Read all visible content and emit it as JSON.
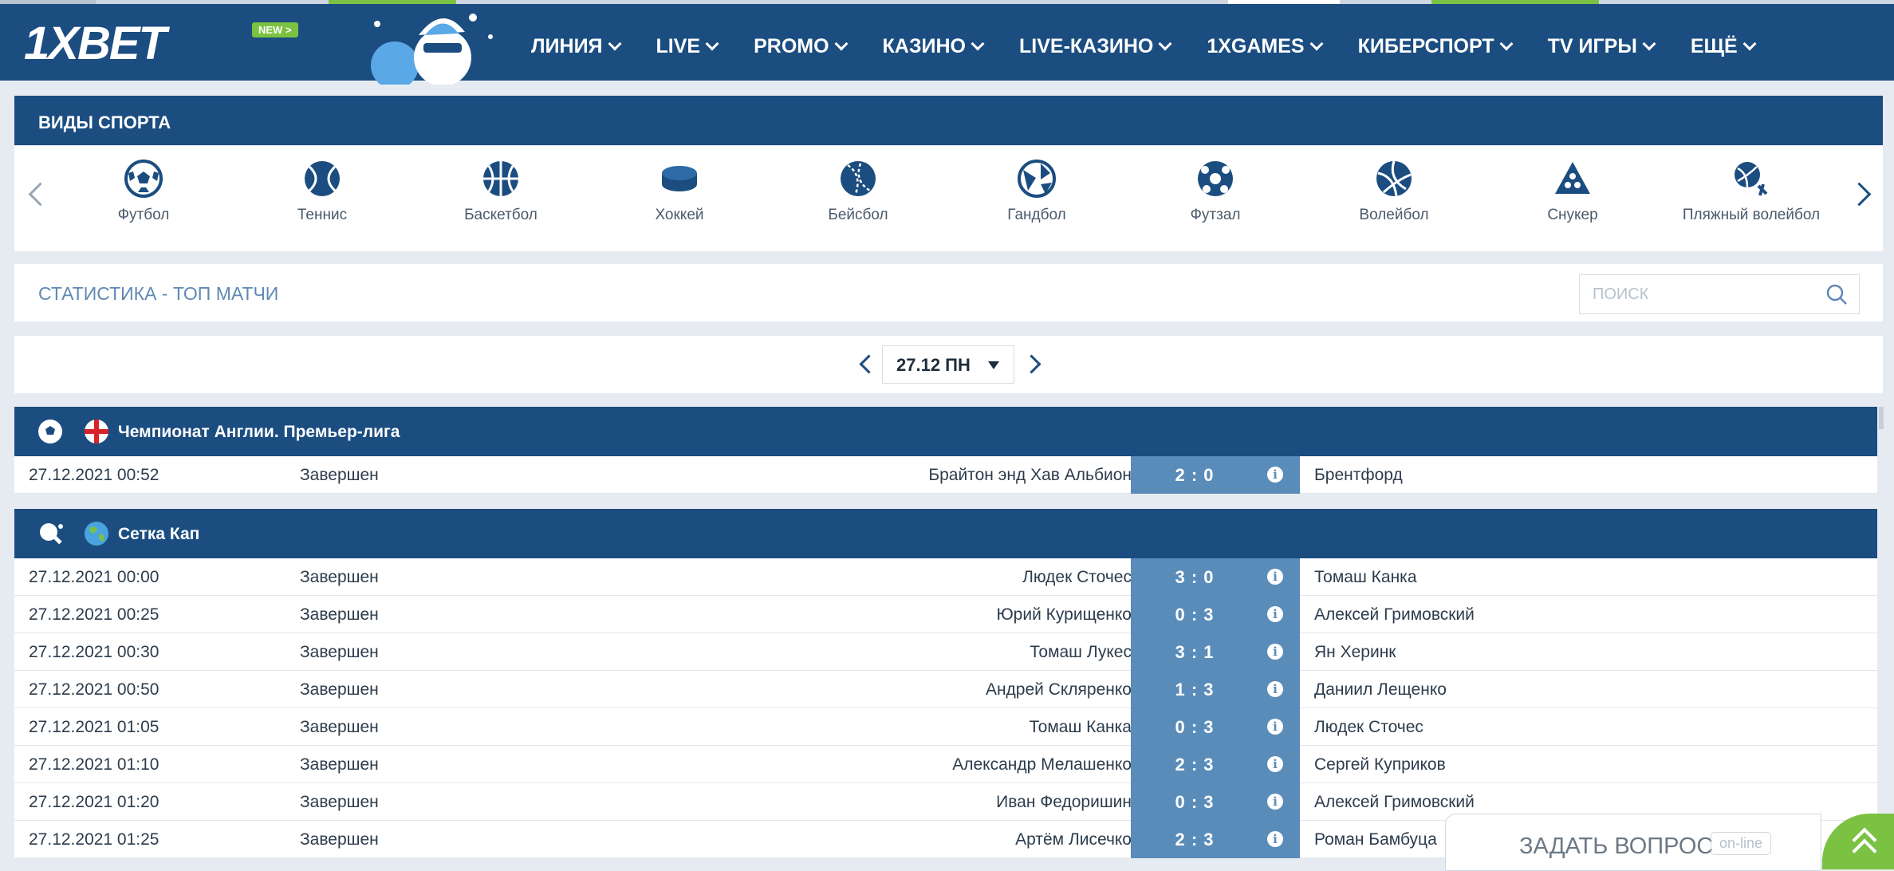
{
  "colors": {
    "brand": "#1b4d80",
    "accent": "#7cc242",
    "score_bg": "#5a8cba",
    "link": "#5f88b4"
  },
  "header": {
    "logo_part1": "1X",
    "logo_part2": "BET",
    "new_badge": "NEW >",
    "nav": [
      "ЛИНИЯ",
      "LIVE",
      "PROMO",
      "КАЗИНО",
      "LIVE-КАЗИНО",
      "1XGAMES",
      "КИБЕРСПОРТ",
      "TV ИГРЫ",
      "ЕЩЁ"
    ]
  },
  "sports_panel": {
    "title": "ВИДЫ СПОРТА",
    "items": [
      {
        "label": "Футбол",
        "icon": "football-icon"
      },
      {
        "label": "Теннис",
        "icon": "tennis-icon"
      },
      {
        "label": "Баскетбол",
        "icon": "basketball-icon"
      },
      {
        "label": "Хоккей",
        "icon": "hockey-puck-icon"
      },
      {
        "label": "Бейсбол",
        "icon": "baseball-icon"
      },
      {
        "label": "Гандбол",
        "icon": "handball-icon"
      },
      {
        "label": "Футзал",
        "icon": "futsal-icon"
      },
      {
        "label": "Волейбол",
        "icon": "volleyball-icon"
      },
      {
        "label": "Снукер",
        "icon": "snooker-icon"
      },
      {
        "label": "Пляжный волейбол",
        "icon": "beach-volleyball-icon"
      }
    ]
  },
  "stats": {
    "title": "СТАТИСТИКА - ТОП МАТЧИ",
    "search_placeholder": "ПОИСК",
    "date": "27.12 ПН"
  },
  "leagues": [
    {
      "name": "Чемпионат Англии. Премьер-лига",
      "sport_icon": "football-icon",
      "flag_icon": "england-flag-icon",
      "matches": [
        {
          "datetime": "27.12.2021 00:52",
          "status": "Завершен",
          "home": "Брайтон энд Хав Альбион",
          "score": "2 : 0",
          "away": "Брентфорд"
        }
      ]
    },
    {
      "name": "Сетка Кап",
      "sport_icon": "table-tennis-icon",
      "flag_icon": "globe-icon",
      "matches": [
        {
          "datetime": "27.12.2021 00:00",
          "status": "Завершен",
          "home": "Людек Сточес",
          "score": "3 : 0",
          "away": "Томаш Канка"
        },
        {
          "datetime": "27.12.2021 00:25",
          "status": "Завершен",
          "home": "Юрий Курищенко",
          "score": "0 : 3",
          "away": "Алексей Гримовский"
        },
        {
          "datetime": "27.12.2021 00:30",
          "status": "Завершен",
          "home": "Томаш Лукес",
          "score": "3 : 1",
          "away": "Ян Херинк"
        },
        {
          "datetime": "27.12.2021 00:50",
          "status": "Завершен",
          "home": "Андрей Скляренко",
          "score": "1 : 3",
          "away": "Даниил Лещенко"
        },
        {
          "datetime": "27.12.2021 01:05",
          "status": "Завершен",
          "home": "Томаш Канка",
          "score": "0 : 3",
          "away": "Людек Сточес"
        },
        {
          "datetime": "27.12.2021 01:10",
          "status": "Завершен",
          "home": "Александр Мелашенко",
          "score": "2 : 3",
          "away": "Сергей Куприков"
        },
        {
          "datetime": "27.12.2021 01:20",
          "status": "Завершен",
          "home": "Иван Федоришин",
          "score": "0 : 3",
          "away": "Алексей Гримовский"
        },
        {
          "datetime": "27.12.2021 01:25",
          "status": "Завершен",
          "home": "Артём Лисечко",
          "score": "2 : 3",
          "away": "Роман Бамбуца"
        }
      ]
    }
  ],
  "chat_widget": {
    "label": "ЗАДАТЬ ВОПРОС",
    "status": "on-line"
  }
}
